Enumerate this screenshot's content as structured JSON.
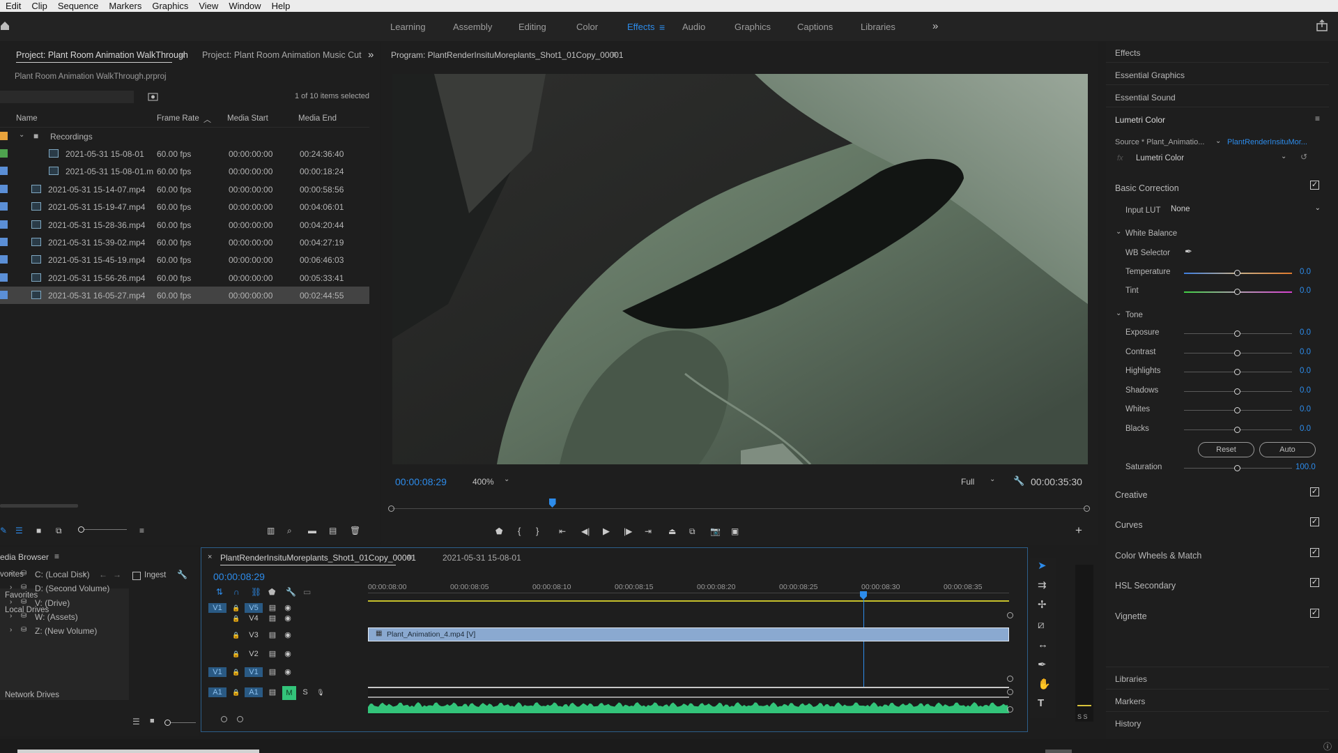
{
  "menu": [
    "Edit",
    "Clip",
    "Sequence",
    "Markers",
    "Graphics",
    "View",
    "Window",
    "Help"
  ],
  "workspaces": {
    "tabs": [
      "Learning",
      "Assembly",
      "Editing",
      "Color",
      "Effects",
      "Audio",
      "Graphics",
      "Captions",
      "Libraries"
    ],
    "active": "Effects",
    "more_icon": "double-chevron-right-icon"
  },
  "project": {
    "tab_active": "Project: Plant Room Animation WalkThrough",
    "tab_inactive": "Project: Plant Room Animation Music Cut",
    "file": "Plant Room Animation WalkThrough.prproj",
    "selection_status": "1 of 10 items selected",
    "columns": [
      "Name",
      "Frame Rate",
      "Media Start",
      "Media End"
    ],
    "folder": "Recordings",
    "items": [
      {
        "name": "2021-05-31 15-08-01",
        "fps": "60.00 fps",
        "start": "00:00:00:00",
        "end": "00:24:36:40",
        "color": "#4ea34e"
      },
      {
        "name": "2021-05-31 15-08-01.m",
        "fps": "60.00 fps",
        "start": "00:00:00:00",
        "end": "00:00:18:24",
        "color": "#5b8fd6"
      },
      {
        "name": "2021-05-31 15-14-07.mp4",
        "fps": "60.00 fps",
        "start": "00:00:00:00",
        "end": "00:00:58:56",
        "color": "#5b8fd6"
      },
      {
        "name": "2021-05-31 15-19-47.mp4",
        "fps": "60.00 fps",
        "start": "00:00:00:00",
        "end": "00:04:06:01",
        "color": "#5b8fd6"
      },
      {
        "name": "2021-05-31 15-28-36.mp4",
        "fps": "60.00 fps",
        "start": "00:00:00:00",
        "end": "00:04:20:44",
        "color": "#5b8fd6"
      },
      {
        "name": "2021-05-31 15-39-02.mp4",
        "fps": "60.00 fps",
        "start": "00:00:00:00",
        "end": "00:04:27:19",
        "color": "#5b8fd6"
      },
      {
        "name": "2021-05-31 15-45-19.mp4",
        "fps": "60.00 fps",
        "start": "00:00:00:00",
        "end": "00:06:46:03",
        "color": "#5b8fd6"
      },
      {
        "name": "2021-05-31 15-56-26.mp4",
        "fps": "60.00 fps",
        "start": "00:00:00:00",
        "end": "00:05:33:41",
        "color": "#5b8fd6"
      },
      {
        "name": "2021-05-31 16-05-27.mp4",
        "fps": "60.00 fps",
        "start": "00:00:00:00",
        "end": "00:02:44:55",
        "color": "#5b8fd6"
      }
    ]
  },
  "program": {
    "title": "Program: PlantRenderInsituMoreplants_Shot1_01Copy_00001",
    "timecode": "00:00:08:29",
    "zoom": "400%",
    "resolution": "Full",
    "duration": "00:00:35:30",
    "playhead_fraction": 0.23
  },
  "media_browser": {
    "title": "edia Browser",
    "dropdown": "vorites",
    "ingest": "Ingest",
    "favorites": "Favorites",
    "local_drives": "Local Drives",
    "drives": [
      "C: (Local Disk)",
      "D: (Second Volume)",
      "V: (Drive)",
      "W: (Assets)",
      "Z: (New Volume)"
    ],
    "network": "Network Drives"
  },
  "timeline": {
    "tab_active": "PlantRenderInsituMoreplants_Shot1_01Copy_00001",
    "tab_inactive": "2021-05-31 15-08-01",
    "timecode": "00:00:08:29",
    "ruler": [
      "00:00:08:00",
      "00:00:08:05",
      "00:00:08:10",
      "00:00:08:15",
      "00:00:08:20",
      "00:00:08:25",
      "00:00:08:30",
      "00:00:08:35"
    ],
    "tracks": [
      "V5",
      "V4",
      "V3",
      "V2",
      "V1",
      "A1"
    ],
    "source_patch_v": "V1",
    "source_patch_a": "A1",
    "clip": "Plant_Animation_4.mp4 [V]",
    "mute": "M",
    "solo": "S"
  },
  "effects_panel": {
    "items": [
      "Effects",
      "Essential Graphics",
      "Essential Sound",
      "Lumetri Color"
    ],
    "source": "Source * Plant_Animatio...",
    "source_link": "PlantRenderInsituMor...",
    "fx_label": "fx",
    "effect": "Lumetri Color",
    "basic_correction": "Basic Correction",
    "input_lut_label": "Input LUT",
    "input_lut_value": "None",
    "white_balance": "White Balance",
    "wb_selector": "WB Selector",
    "tone": "Tone",
    "sliders": [
      {
        "label": "Temperature",
        "value": "0.0"
      },
      {
        "label": "Tint",
        "value": "0.0"
      },
      {
        "label": "Exposure",
        "value": "0.0"
      },
      {
        "label": "Contrast",
        "value": "0.0"
      },
      {
        "label": "Highlights",
        "value": "0.0"
      },
      {
        "label": "Shadows",
        "value": "0.0"
      },
      {
        "label": "Whites",
        "value": "0.0"
      },
      {
        "label": "Blacks",
        "value": "0.0"
      },
      {
        "label": "Saturation",
        "value": "100.0"
      }
    ],
    "reset": "Reset",
    "auto": "Auto",
    "sections": [
      "Creative",
      "Curves",
      "Color Wheels & Match",
      "HSL Secondary",
      "Vignette"
    ],
    "footer": [
      "Libraries",
      "Markers",
      "History"
    ]
  },
  "meter": {
    "scale": "S S"
  },
  "colors": {
    "accent": "#2d8ceb",
    "clip_video": "#8aa9d0",
    "clip_audio": "#33c47a",
    "workarea": "#c7c12b"
  }
}
